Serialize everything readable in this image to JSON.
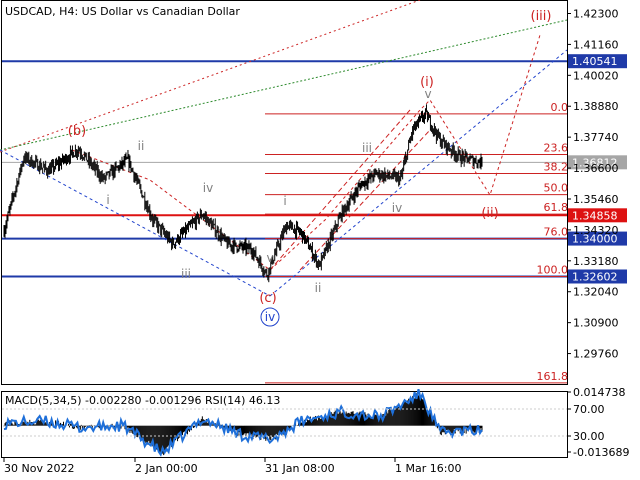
{
  "header": {
    "symbol_title": "USDCAD, H4:  US Dollar vs Canadian Dollar"
  },
  "main_price_axis": {
    "ticks": [
      "1.42300",
      "1.41160",
      "1.40020",
      "1.38880",
      "1.37740",
      "1.36600",
      "1.35460",
      "1.34320",
      "1.33180",
      "1.32040",
      "1.30900",
      "1.29760"
    ]
  },
  "tagged_levels": [
    {
      "label": "1.40541",
      "value": 1.40541,
      "color": "#1f3aa8"
    },
    {
      "label": "1.36812",
      "value": 1.36812,
      "color": "#a6a6a6"
    },
    {
      "label": "1.34858",
      "value": 1.34858,
      "color": "#dd1111"
    },
    {
      "label": "1.34000",
      "value": 1.34,
      "color": "#1f3aa8"
    },
    {
      "label": "1.32602",
      "value": 1.32602,
      "color": "#1f3aa8"
    }
  ],
  "fib_levels": [
    {
      "label": "0.0",
      "value": 1.386
    },
    {
      "label": "23.6",
      "value": 1.371
    },
    {
      "label": "38.2",
      "value": 1.364
    },
    {
      "label": "50.0",
      "value": 1.3562
    },
    {
      "label": "61.8",
      "value": 1.349
    },
    {
      "label": "76.0",
      "value": 1.34
    },
    {
      "label": "100.0",
      "value": 1.326
    },
    {
      "label": "161.8",
      "value": 1.2868
    }
  ],
  "wave_labels": {
    "b": "(b)",
    "c": "(c)",
    "iv_circle": "iv",
    "roman_i": "(i)",
    "roman_ii": "(ii)",
    "roman_iii": "(iii)",
    "sub_ii_top": "ii",
    "sub_i_left": "i",
    "sub_iv_left": "iv",
    "sub_iii_left": "iii",
    "sub_v_left": "v",
    "sub_i_mid": "i",
    "sub_ii_mid": "ii",
    "sub_iii_mid": "iii",
    "sub_iv_mid": "iv",
    "sub_v_mid": "v"
  },
  "indicator": {
    "label": "MACD(5,34,5) -0.002280 -0.001296 RSI(14) 46.13",
    "axis_ticks": [
      "0.014738",
      "70.00",
      "30.00",
      "-0.013689"
    ]
  },
  "time_axis": {
    "ticks": [
      "30 Nov 2022",
      "2 Jan 00:00",
      "31 Jan 08:00",
      "1 Mar 16:00"
    ]
  },
  "colors": {
    "candles": "#000000",
    "blue_level": "#1f3aa8",
    "red_level": "#dd1111",
    "fib_line": "#cc2222",
    "wave_red": "#cc2222",
    "wave_blue": "#2244cc",
    "wave_grey": "#808080",
    "green_channel": "#2e8b2e",
    "macd_hist": "#000000",
    "rsi_line": "#1e6fd9",
    "label_bg_blue": "#1f3aa8",
    "label_bg_red": "#dd1111",
    "label_bg_grey": "#a6a6a6"
  },
  "chart_data": {
    "type": "candlestick",
    "title": "USDCAD, H4:  US Dollar vs Canadian Dollar",
    "xlabel": "",
    "ylabel": "",
    "ylim": [
      1.2908,
      1.4265
    ],
    "x_tick_labels": [
      "30 Nov 2022",
      "2 Jan 00:00",
      "31 Jan 08:00",
      "1 Mar 16:00"
    ],
    "price_path_anchors": [
      {
        "bar": 0,
        "price": 1.343
      },
      {
        "bar": 20,
        "price": 1.37
      },
      {
        "bar": 45,
        "price": 1.365
      },
      {
        "bar": 75,
        "price": 1.373
      },
      {
        "bar": 100,
        "price": 1.362
      },
      {
        "bar": 125,
        "price": 1.369
      },
      {
        "bar": 150,
        "price": 1.347
      },
      {
        "bar": 170,
        "price": 1.338
      },
      {
        "bar": 200,
        "price": 1.349
      },
      {
        "bar": 225,
        "price": 1.338
      },
      {
        "bar": 250,
        "price": 1.336
      },
      {
        "bar": 265,
        "price": 1.3268
      },
      {
        "bar": 285,
        "price": 1.345
      },
      {
        "bar": 300,
        "price": 1.342
      },
      {
        "bar": 318,
        "price": 1.33
      },
      {
        "bar": 340,
        "price": 1.349
      },
      {
        "bar": 360,
        "price": 1.36
      },
      {
        "bar": 375,
        "price": 1.364
      },
      {
        "bar": 400,
        "price": 1.362
      },
      {
        "bar": 412,
        "price": 1.38
      },
      {
        "bar": 425,
        "price": 1.386
      },
      {
        "bar": 440,
        "price": 1.376
      },
      {
        "bar": 460,
        "price": 1.37
      },
      {
        "bar": 482,
        "price": 1.3681
      }
    ],
    "macd_path_anchors": [
      {
        "bar": 0,
        "value": 0.001
      },
      {
        "bar": 40,
        "value": 0.002
      },
      {
        "bar": 80,
        "value": -0.001
      },
      {
        "bar": 120,
        "value": 0.0
      },
      {
        "bar": 160,
        "value": -0.012
      },
      {
        "bar": 200,
        "value": 0.003
      },
      {
        "bar": 240,
        "value": -0.004
      },
      {
        "bar": 270,
        "value": -0.006
      },
      {
        "bar": 300,
        "value": 0.002
      },
      {
        "bar": 340,
        "value": 0.006
      },
      {
        "bar": 380,
        "value": 0.004
      },
      {
        "bar": 420,
        "value": 0.014
      },
      {
        "bar": 440,
        "value": -0.003
      },
      {
        "bar": 482,
        "value": -0.002
      }
    ],
    "rsi_last": 46.13,
    "macd_last": -0.00228,
    "macd_signal_last": -0.001296
  }
}
